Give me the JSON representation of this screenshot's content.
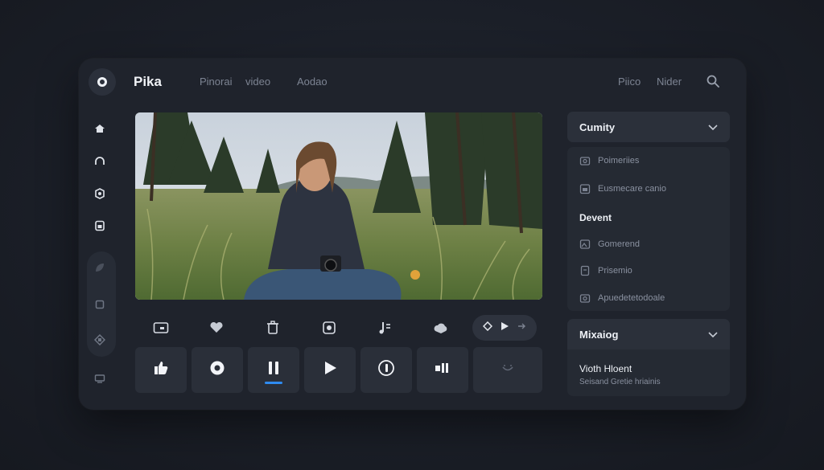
{
  "app": {
    "title": "Pika"
  },
  "header": {
    "nav": [
      "Pinorai",
      "video",
      "Aodao"
    ],
    "right_nav": [
      "Piico",
      "Nider"
    ]
  },
  "sidebar": {
    "icons": [
      "home-icon",
      "headphones-icon",
      "badge-icon",
      "layers-icon",
      "leaf-icon",
      "square-icon",
      "shapes-icon",
      "screen-icon"
    ]
  },
  "toolbar": {
    "icons": [
      "camera-icon",
      "heart-icon",
      "trash-icon",
      "record-icon",
      "music-icon",
      "cloud-icon"
    ],
    "pill_icons": [
      "diamond-icon",
      "play-icon",
      "forward-icon"
    ]
  },
  "controls": [
    {
      "name": "like-button",
      "icon": "thumbs-up-icon"
    },
    {
      "name": "target-button",
      "icon": "target-icon"
    },
    {
      "name": "pause-button",
      "icon": "pause-icon",
      "active": true
    },
    {
      "name": "play-button",
      "icon": "play-icon"
    },
    {
      "name": "replay-button",
      "icon": "replay-icon"
    },
    {
      "name": "bars-button",
      "icon": "bars-icon"
    },
    {
      "name": "smile-button",
      "icon": "smile-icon"
    }
  ],
  "right_panel": {
    "dropdown1": "Cumity",
    "items1": [
      "Poimeriies",
      "Eusmecare canio"
    ],
    "section": "Devent",
    "items2": [
      "Gomerend",
      "Prisemio",
      "Apuedetetodoale"
    ],
    "dropdown2": "Mixaiog",
    "bottom_title": "Vioth Hloent",
    "bottom_sub": "Seisand Gretie hriainis"
  },
  "colors": {
    "accent": "#2f8bf0",
    "panel": "#2b303a",
    "bg": "#1f232c"
  }
}
